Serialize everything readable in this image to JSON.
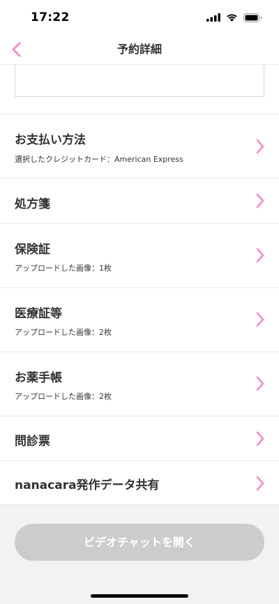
{
  "status_bar": {
    "time": "17:22"
  },
  "header": {
    "title": "予約詳細"
  },
  "rows": [
    {
      "title": "お支払い方法",
      "subtitle": "選択したクレジットカード：American Express"
    },
    {
      "title": "処方箋"
    },
    {
      "title": "保険証",
      "subtitle": "アップロードした画像：1枚"
    },
    {
      "title": "医療証等",
      "subtitle": "アップロードした画像：2枚"
    },
    {
      "title": "お薬手帳",
      "subtitle": "アップロードした画像：2枚"
    },
    {
      "title": "問診票"
    },
    {
      "title": "nanacara発作データ共有"
    }
  ],
  "footer": {
    "video_button_label": "ビデオチャットを開く"
  },
  "colors": {
    "accent": "#f08cc8",
    "button_disabled": "#cccccc",
    "footer_bg": "#f2f2f2"
  }
}
